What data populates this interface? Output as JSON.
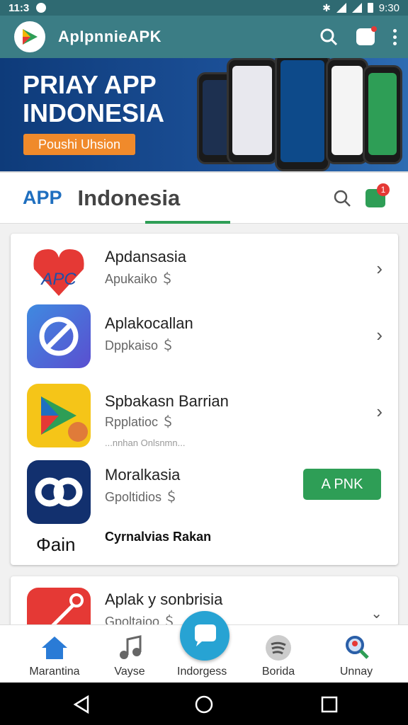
{
  "status_bar": {
    "time": "11:3",
    "clock": "9:30"
  },
  "app_bar": {
    "title": "ApIpnnieAPK"
  },
  "banner": {
    "title_line1": "PRIAY APP",
    "title_line2": "INDONESIA",
    "cta_label": "Poushi Uhsion"
  },
  "tabs": {
    "app_label": "APP",
    "title": "Indonesia",
    "notification_count": "1"
  },
  "apps": [
    {
      "name": "Apdansasia",
      "subtitle": "Apukaiko ＄"
    },
    {
      "name": "Aplakocallan",
      "subtitle": "Dppkaiso ＄"
    },
    {
      "name": "Spbakasn Barrian",
      "subtitle": "Rpplatioc ＄",
      "extra": "...nnhan Onlsnmn..."
    },
    {
      "name": "Moralkasia",
      "subtitle": "Gpoltidios ＄",
      "install_label": "A PNK",
      "footer_icon_text": "Φain",
      "footer_text": "Cyrnalvias Rakan"
    }
  ],
  "next_app": {
    "name": "Aplak y sonbrisia",
    "subtitle": "Gpoltaioo ＄"
  },
  "bottom_nav": [
    {
      "label": "Marantina",
      "icon": "home-icon"
    },
    {
      "label": "Vayse",
      "icon": "music-icon"
    },
    {
      "label": "Indorgess",
      "icon": "chat-icon"
    },
    {
      "label": "Borida",
      "icon": "spotify-icon"
    },
    {
      "label": "Unnay",
      "icon": "search-person-icon"
    }
  ],
  "colors": {
    "primary": "#3b7d85",
    "accent": "#2e9e56",
    "badge": "#e53935"
  }
}
